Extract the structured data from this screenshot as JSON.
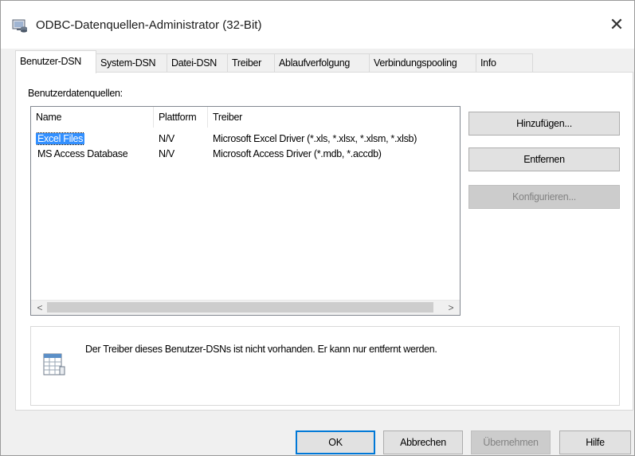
{
  "window": {
    "title": "ODBC-Datenquellen-Administrator (32-Bit)",
    "close_glyph": "✕"
  },
  "tabs": [
    {
      "label": "Benutzer-DSN",
      "active": true
    },
    {
      "label": "System-DSN",
      "active": false
    },
    {
      "label": "Datei-DSN",
      "active": false
    },
    {
      "label": "Treiber",
      "active": false
    },
    {
      "label": "Ablaufverfolgung",
      "active": false
    },
    {
      "label": "Verbindungspooling",
      "active": false
    },
    {
      "label": "Info",
      "active": false
    }
  ],
  "panel": {
    "section_label": "Benutzerdatenquellen:",
    "columns": [
      "Name",
      "Plattform",
      "Treiber"
    ],
    "rows": [
      {
        "name": "Excel Files",
        "platform": "N/V",
        "driver": "Microsoft Excel Driver (*.xls, *.xlsx, *.xlsm, *.xlsb)",
        "selected": true
      },
      {
        "name": "MS Access Database",
        "platform": "N/V",
        "driver": "Microsoft Access Driver (*.mdb, *.accdb)",
        "selected": false
      }
    ],
    "scroll_left_glyph": "<",
    "scroll_right_glyph": ">",
    "buttons": {
      "add": "Hinzufügen...",
      "remove": "Entfernen",
      "configure": "Konfigurieren..."
    },
    "info_text": "Der Treiber dieses Benutzer-DSNs ist nicht vorhanden. Er kann nur entfernt werden."
  },
  "footer": {
    "ok": "OK",
    "cancel": "Abbrechen",
    "apply": "Übernehmen",
    "help": "Hilfe"
  },
  "colors": {
    "selection": "#3390ff",
    "default_button_border": "#0078d7"
  },
  "icons": {
    "title": "odbc-admin-icon",
    "info": "data-table-icon"
  }
}
